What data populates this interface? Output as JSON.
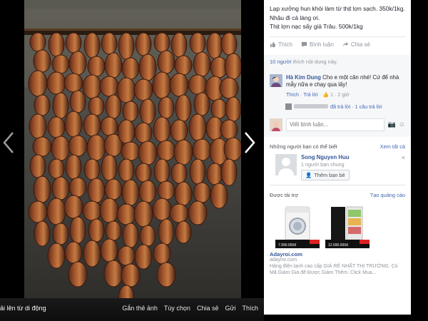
{
  "photo": {
    "upload_note": "ải lên từ di động",
    "actions": [
      "Gắn thẻ ảnh",
      "Tùy chọn",
      "Chia sẻ",
      "Gửi",
      "Thích"
    ]
  },
  "post": {
    "caption": "Lạp xưởng hun khói làm từ thịt lợn sạch. 350k/1kg.\nNhậu đi cả làng ơi.\nThịt lợn nạc sấy giả Trâu. 500k/1kg",
    "actions": {
      "like": "Thích",
      "comment": "Bình luận",
      "share": "Chia sẻ"
    },
    "likes": {
      "count": "10 người",
      "suffix": " thích nội dung này."
    }
  },
  "comment": {
    "author": "Hà Kim Dung",
    "text": " Cho e một cân nhé! Cứ để nhà mẫy nữa e chạy qua lấy!",
    "like": "Thích",
    "reply": "Trả lời",
    "likes_count": "1",
    "time": "2 giờ",
    "reply_summary": "đã trả lời · 1 câu trả lời"
  },
  "composer": {
    "placeholder": "Viết bình luận..."
  },
  "suggestions": {
    "heading": "Những người bạn có thể biết",
    "see_all": "Xem tất cả",
    "person": {
      "name": "Song Nguyen Huu",
      "mutual": "1 người bạn chung",
      "add": "Thêm bạn bè"
    }
  },
  "sponsored": {
    "heading": "Được tài trợ",
    "create": "Tạo quảng cáo",
    "ad_prices": [
      "7.990.000đ",
      "12.690.000đ"
    ],
    "ad_labels": [
      "MIỄN PHÍ VẬN CHUYỂN",
      "MIỄN PHÍ VẬN CHUYỂN"
    ],
    "title": "Adayroi.com",
    "domain": "adayroi.com",
    "description": "Hàng điện lạnh cao cấp GIÁ RẺ NHẤT THỊ TRƯỜNG. Có Mã Giảm Giá để Được Giảm Thêm. Click Mua..."
  },
  "colors": {
    "link": "#365899",
    "accent": "#4267b2",
    "muted": "#90949c"
  }
}
